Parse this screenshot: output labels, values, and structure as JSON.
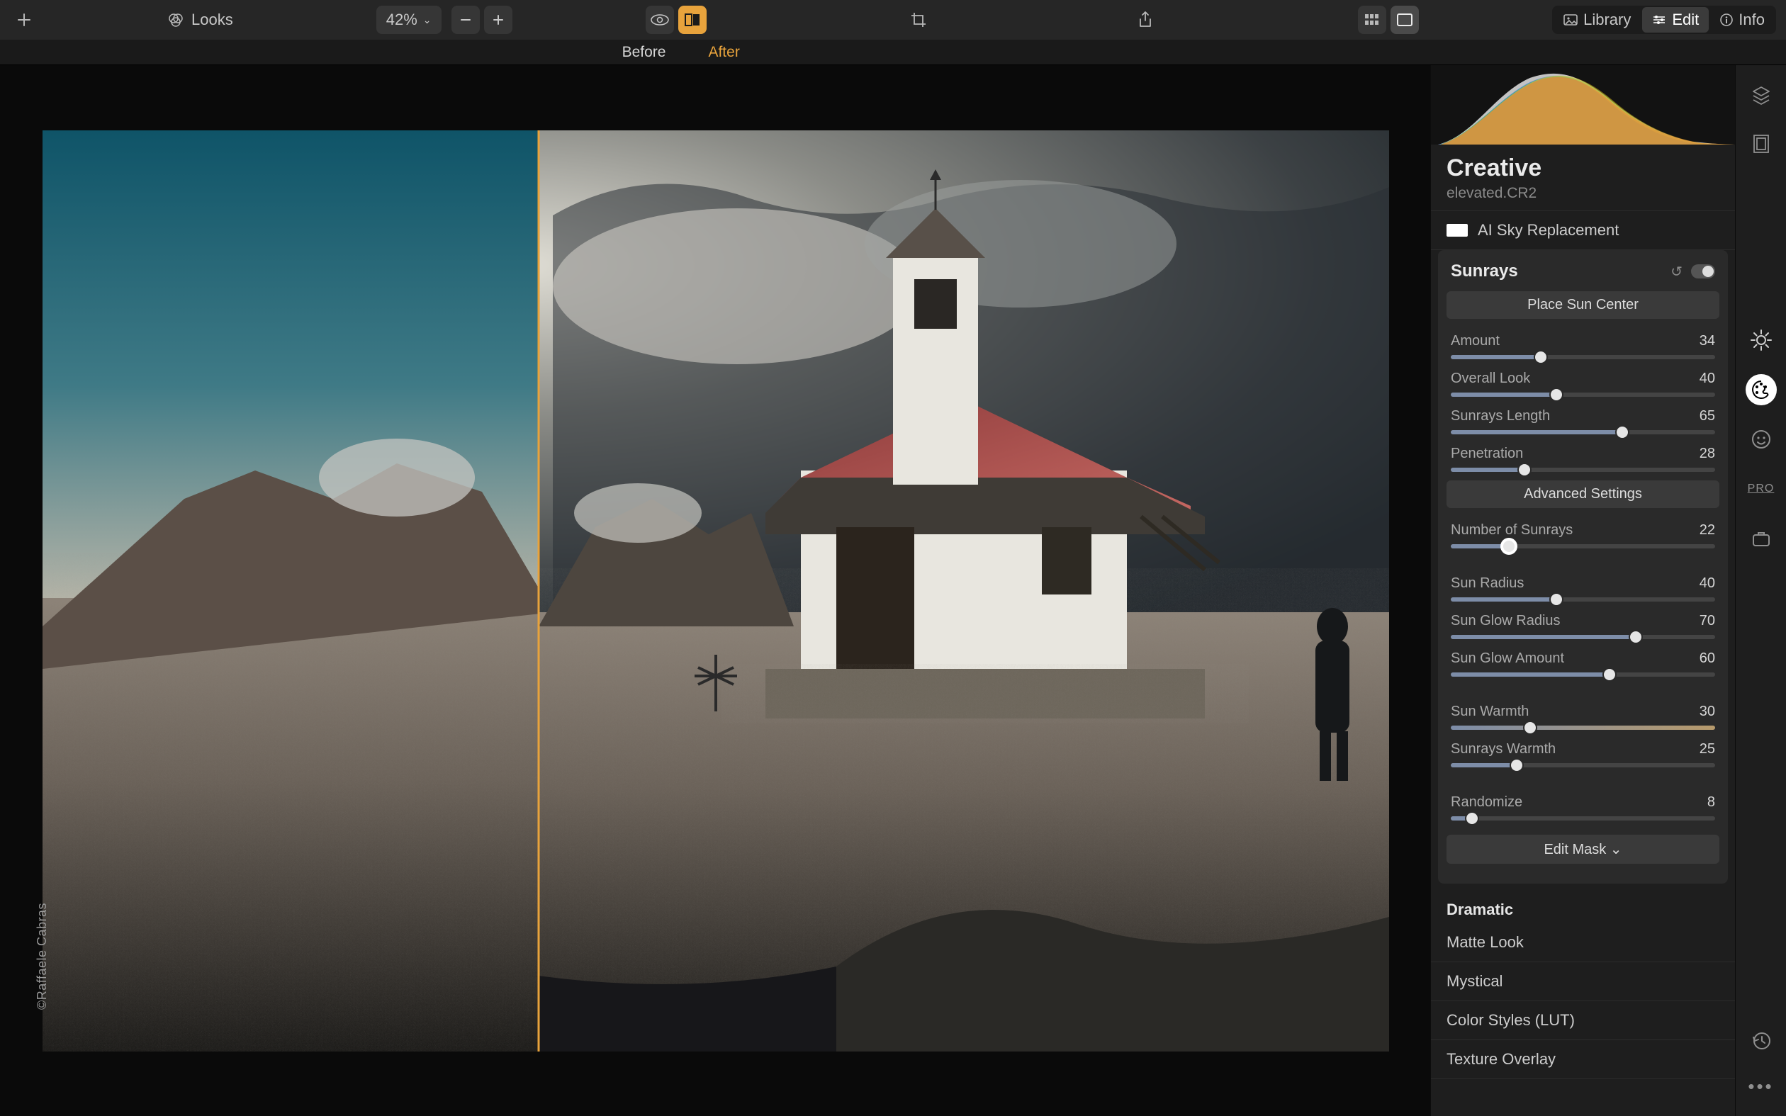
{
  "toolbar": {
    "looks_label": "Looks",
    "zoom_label": "42%",
    "tabs": {
      "library": "Library",
      "edit": "Edit",
      "info": "Info"
    }
  },
  "compare": {
    "before_label": "Before",
    "after_label": "After"
  },
  "canvas": {
    "credit": "©Raffaele Cabras"
  },
  "panel": {
    "title": "Creative",
    "filename": "elevated.CR2",
    "ai_sky": "AI Sky Replacement",
    "sunrays": {
      "title": "Sunrays",
      "place_sun": "Place Sun Center",
      "adv_settings": "Advanced Settings",
      "edit_mask": "Edit Mask ⌄",
      "params": [
        {
          "label": "Amount",
          "value": 34,
          "max": 100
        },
        {
          "label": "Overall Look",
          "value": 40,
          "max": 100
        },
        {
          "label": "Sunrays Length",
          "value": 65,
          "max": 100
        },
        {
          "label": "Penetration",
          "value": 28,
          "max": 100
        }
      ],
      "adv_params": [
        {
          "label": "Number of Sunrays",
          "value": 22,
          "max": 100,
          "highlight": true
        }
      ],
      "radius_params": [
        {
          "label": "Sun Radius",
          "value": 40,
          "max": 100
        },
        {
          "label": "Sun Glow Radius",
          "value": 70,
          "max": 100
        },
        {
          "label": "Sun Glow Amount",
          "value": 60,
          "max": 100
        }
      ],
      "warmth_params": [
        {
          "label": "Sun Warmth",
          "value": 30,
          "max": 100,
          "warm": true
        },
        {
          "label": "Sunrays Warmth",
          "value": 25,
          "max": 100
        }
      ],
      "randomize": {
        "label": "Randomize",
        "value": 8,
        "max": 100
      }
    },
    "other_filters": [
      "Dramatic",
      "Matte Look",
      "Mystical",
      "Color Styles (LUT)",
      "Texture Overlay"
    ]
  }
}
